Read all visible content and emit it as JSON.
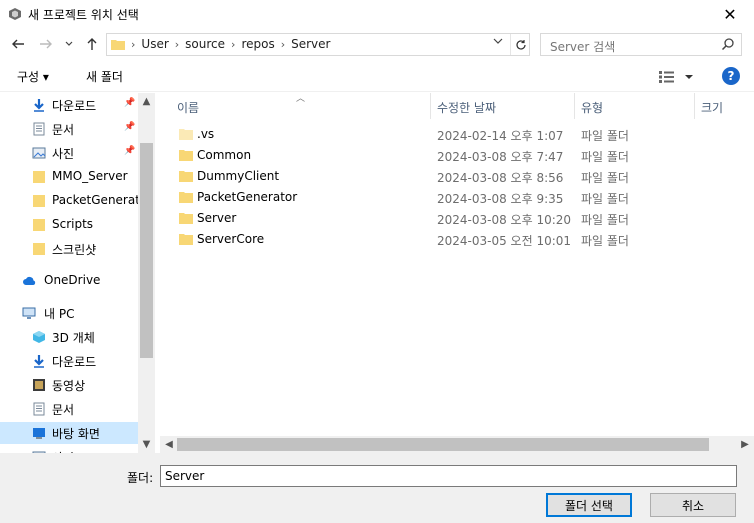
{
  "window": {
    "title": "새 프로젝트 위치 선택",
    "close": "✕"
  },
  "nav": {
    "breadcrumbs": [
      "User",
      "source",
      "repos",
      "Server"
    ],
    "search_placeholder": "Server 검색"
  },
  "toolbar": {
    "organize": "구성 ▾",
    "new_folder": "새 폴더",
    "help": "?"
  },
  "sidebar": {
    "items": [
      {
        "label": "다운로드",
        "icon": "download-arrow-icon",
        "pinned": true
      },
      {
        "label": "문서",
        "icon": "document-icon",
        "pinned": true
      },
      {
        "label": "사진",
        "icon": "pictures-icon",
        "pinned": true
      },
      {
        "label": "MMO_Server",
        "icon": "folder-icon",
        "pinned": false
      },
      {
        "label": "PacketGenerator",
        "icon": "folder-icon",
        "pinned": false
      },
      {
        "label": "Scripts",
        "icon": "folder-icon",
        "pinned": false
      },
      {
        "label": "스크린샷",
        "icon": "folder-icon",
        "pinned": false
      },
      {
        "label": "OneDrive",
        "icon": "cloud-icon",
        "pinned": false
      },
      {
        "label": "내 PC",
        "icon": "pc-icon",
        "pinned": false
      },
      {
        "label": "3D 개체",
        "icon": "3d-objects-icon",
        "pinned": false
      },
      {
        "label": "다운로드",
        "icon": "download-arrow-icon",
        "pinned": false
      },
      {
        "label": "동영상",
        "icon": "video-icon",
        "pinned": false
      },
      {
        "label": "문서",
        "icon": "document-icon",
        "pinned": false
      },
      {
        "label": "바탕 화면",
        "icon": "desktop-icon",
        "pinned": false,
        "selected": true
      },
      {
        "label": "사진",
        "icon": "pictures-icon",
        "pinned": false
      }
    ]
  },
  "filelist": {
    "columns": {
      "name": "이름",
      "modified": "수정한 날짜",
      "type": "유형",
      "size": "크기"
    },
    "rows": [
      {
        "name": ".vs",
        "modified": "2024-02-14 오후 1:07",
        "type": "파일 폴더",
        "hidden": true
      },
      {
        "name": "Common",
        "modified": "2024-03-08 오후 7:47",
        "type": "파일 폴더"
      },
      {
        "name": "DummyClient",
        "modified": "2024-03-08 오후 8:56",
        "type": "파일 폴더"
      },
      {
        "name": "PacketGenerator",
        "modified": "2024-03-08 오후 9:35",
        "type": "파일 폴더"
      },
      {
        "name": "Server",
        "modified": "2024-03-08 오후 10:20",
        "type": "파일 폴더"
      },
      {
        "name": "ServerCore",
        "modified": "2024-03-05 오전 10:01",
        "type": "파일 폴더"
      }
    ]
  },
  "bottom": {
    "folder_label": "폴더:",
    "folder_value": "Server",
    "select_button": "폴더 선택",
    "cancel_button": "취소"
  },
  "colors": {
    "folder": "#f8d775",
    "folder_hidden": "#fbeab6",
    "accent": "#0078d7",
    "selected": "#cce8ff"
  }
}
